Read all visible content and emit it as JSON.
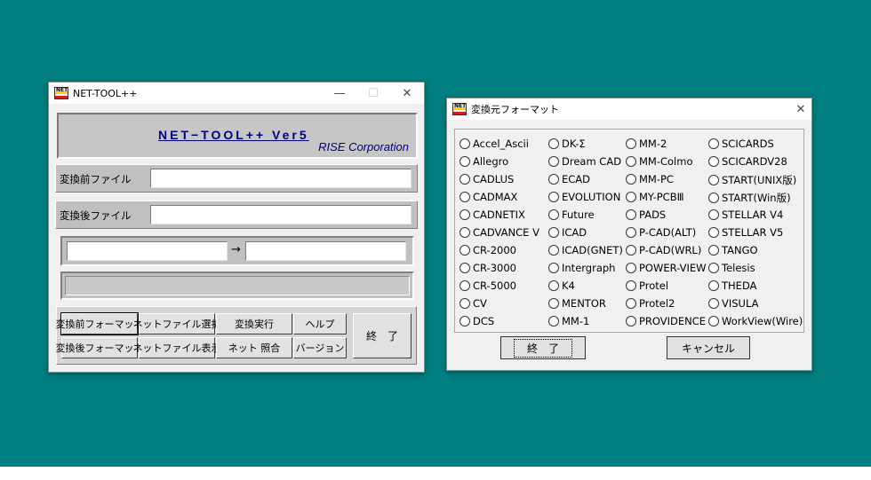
{
  "main_window": {
    "title": "NET-TOOL++",
    "icon_text": "NET",
    "controls": {
      "minimize": "—",
      "maximize": "☐",
      "close": "✕"
    },
    "banner_title": "NET−TOOL++  Ver5",
    "banner_subtitle": "RISE Corporation",
    "source_file_label": "変換前ファイル",
    "source_file_value": "",
    "dest_file_label": "変換後ファイル",
    "dest_file_value": "",
    "route_from": "",
    "route_arrow": "→",
    "route_to": "",
    "buttons": {
      "source_format": "変換前フォーマット",
      "dest_format": "変換後フォーマット",
      "netfile_select": "ネットファイル選択",
      "netfile_show": "ネットファイル表示",
      "execute": "変換実行",
      "net_compare": "ネット 照合",
      "help": "ヘルプ",
      "version": "バージョン",
      "exit": "終　了"
    }
  },
  "format_dialog": {
    "title": "変換元フォーマット",
    "icon_text": "NET",
    "close": "✕",
    "formats": [
      [
        "Accel_Ascii",
        "Allegro",
        "CADLUS",
        "CADMAX",
        "CADNETIX",
        "CADVANCE V",
        "CR-2000",
        "CR-3000",
        "CR-5000",
        "CV",
        "DCS"
      ],
      [
        "DK-Σ",
        "Dream CAD",
        "ECAD",
        "EVOLUTION",
        "Future",
        "ICAD",
        "ICAD(GNET)",
        "Intergraph",
        "K4",
        "MENTOR",
        "MM-1"
      ],
      [
        "MM-2",
        "MM-Colmo",
        "MM-PC",
        "MY-PCBⅢ",
        "PADS",
        "P-CAD(ALT)",
        "P-CAD(WRL)",
        "POWER-VIEW",
        "Protel",
        "Protel2",
        "PROVIDENCE"
      ],
      [
        "SCICARDS",
        "SCICARDV28",
        "START(UNIX版)",
        "START(Win版)",
        "STELLAR V4",
        "STELLAR V5",
        "TANGO",
        "Telesis",
        "THEDA",
        "VISULA",
        "WorkView(Wire)"
      ]
    ],
    "ok_label": "終　了",
    "cancel_label": "キャンセル"
  }
}
